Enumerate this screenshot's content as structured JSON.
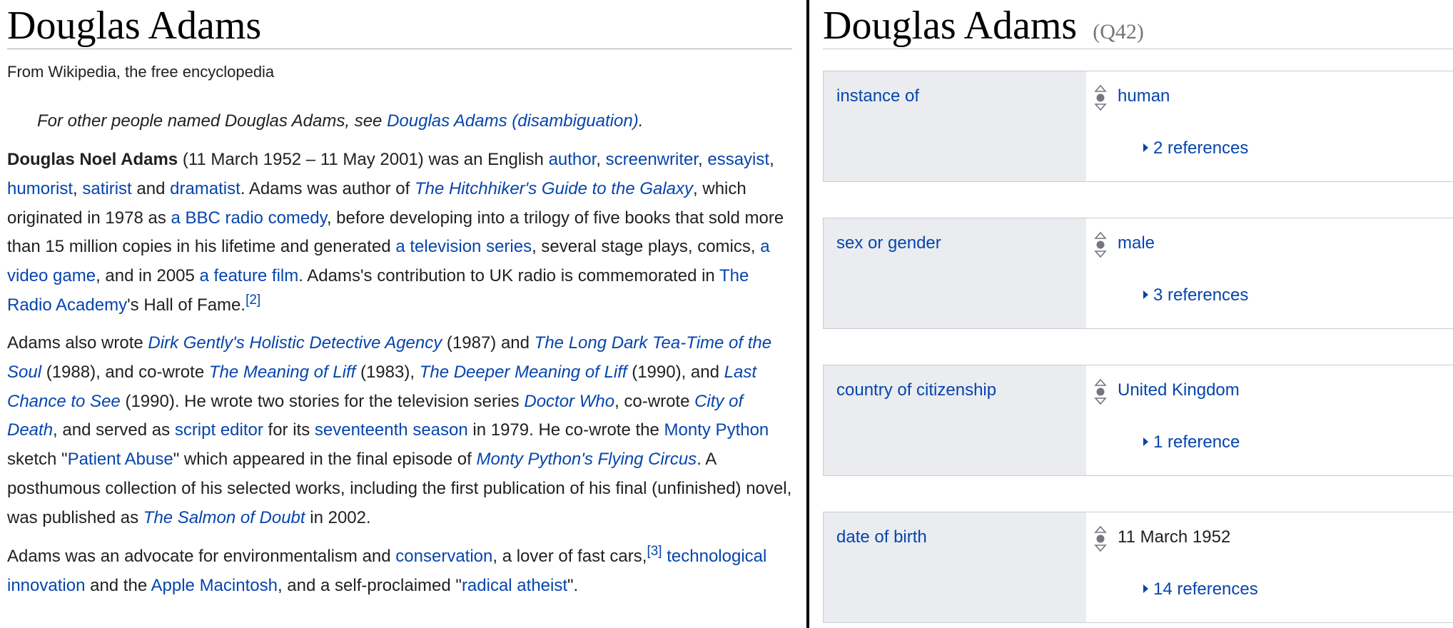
{
  "wikipedia": {
    "title": "Douglas Adams",
    "tagline": "From Wikipedia, the free encyclopedia",
    "hatnote": {
      "prefix": "For other people named Douglas Adams, see ",
      "link": "Douglas Adams (disambiguation)",
      "suffix": "."
    },
    "p1": {
      "bold_name": "Douglas Noel Adams",
      "t1": " (11 March 1952 – 11 May 2001) was an English ",
      "l_author": "author",
      "t2": ", ",
      "l_screenwriter": "screenwriter",
      "t3": ", ",
      "l_essayist": "essayist",
      "t4": ", ",
      "l_humorist": "humorist",
      "t5": ", ",
      "l_satirist": "satirist",
      "t6": " and ",
      "l_dramatist": "dramatist",
      "t7": ". Adams was author of ",
      "l_hitchhiker": "The Hitchhiker's Guide to the Galaxy",
      "t8": ", which originated in 1978 as ",
      "l_bbc_radio": "a BBC radio comedy",
      "t9": ", before developing into a trilogy of five books that sold more than 15 million copies in his lifetime and generated ",
      "l_tv_series": "a television series",
      "t10": ", several stage plays, comics, ",
      "l_video_game": "a video game",
      "t11": ", and in 2005 ",
      "l_feature_film": "a feature film",
      "t12": ". Adams's contribution to UK radio is commemorated in ",
      "l_radio_academy": "The Radio Academy",
      "t13": "'s Hall of Fame.",
      "ref": "[2]"
    },
    "p2": {
      "t1": "Adams also wrote ",
      "l_dirk": "Dirk Gently's Holistic Detective Agency",
      "t2": " (1987) and ",
      "l_long_dark": "The Long Dark Tea-Time of the Soul",
      "t3": " (1988), and co-wrote ",
      "l_liff": "The Meaning of Liff",
      "t4": " (1983), ",
      "l_deeper_liff": "The Deeper Meaning of Liff",
      "t5": " (1990), and ",
      "l_last_chance": "Last Chance to See",
      "t6": " (1990). He wrote two stories for the television series ",
      "l_doctor_who": "Doctor Who",
      "t7": ", co-wrote ",
      "l_city_death": "City of Death",
      "t8": ", and served as ",
      "l_script_editor": "script editor",
      "t9": " for its ",
      "l_seventeenth": "seventeenth season",
      "t10": " in 1979. He co-wrote the ",
      "l_monty_python": "Monty Python",
      "t11": " sketch \"",
      "l_patient_abuse": "Patient Abuse",
      "t12": "\" which appeared in the final episode of ",
      "l_flying_circus": "Monty Python's Flying Circus",
      "t13": ". A posthumous collection of his selected works, including the first publication of his final (unfinished) novel, was published as ",
      "l_salmon": "The Salmon of Doubt",
      "t14": " in 2002."
    },
    "p3": {
      "t1": "Adams was an advocate for environmentalism and ",
      "l_conservation": "conservation",
      "t2": ", a lover of fast cars,",
      "ref": "[3]",
      "t3": " ",
      "l_tech_innovation": "technological innovation",
      "t4": " and the ",
      "l_apple_mac": "Apple Macintosh",
      "t5": ", and a self-proclaimed \"",
      "l_radical_atheist": "radical atheist",
      "t6": "\"."
    }
  },
  "wikidata": {
    "label": "Douglas Adams",
    "qid": "(Q42)",
    "statements": [
      {
        "property": "instance of",
        "value": "human",
        "references": "2 references"
      },
      {
        "property": "sex or gender",
        "value": "male",
        "references": "3 references"
      },
      {
        "property": "country of citizenship",
        "value": "United Kingdom",
        "references": "1 reference"
      },
      {
        "property": "date of birth",
        "value": "11 March 1952",
        "references": "14 references"
      }
    ]
  },
  "icons": {
    "rank": "rank-normal-icon",
    "references_toggle": "triangle-right-icon"
  },
  "colors": {
    "link": "#0645ad",
    "text": "#202122",
    "property_background": "#eaecf0",
    "border": "#c8ccd1",
    "muted": "#72777d",
    "divider": "#000000"
  }
}
